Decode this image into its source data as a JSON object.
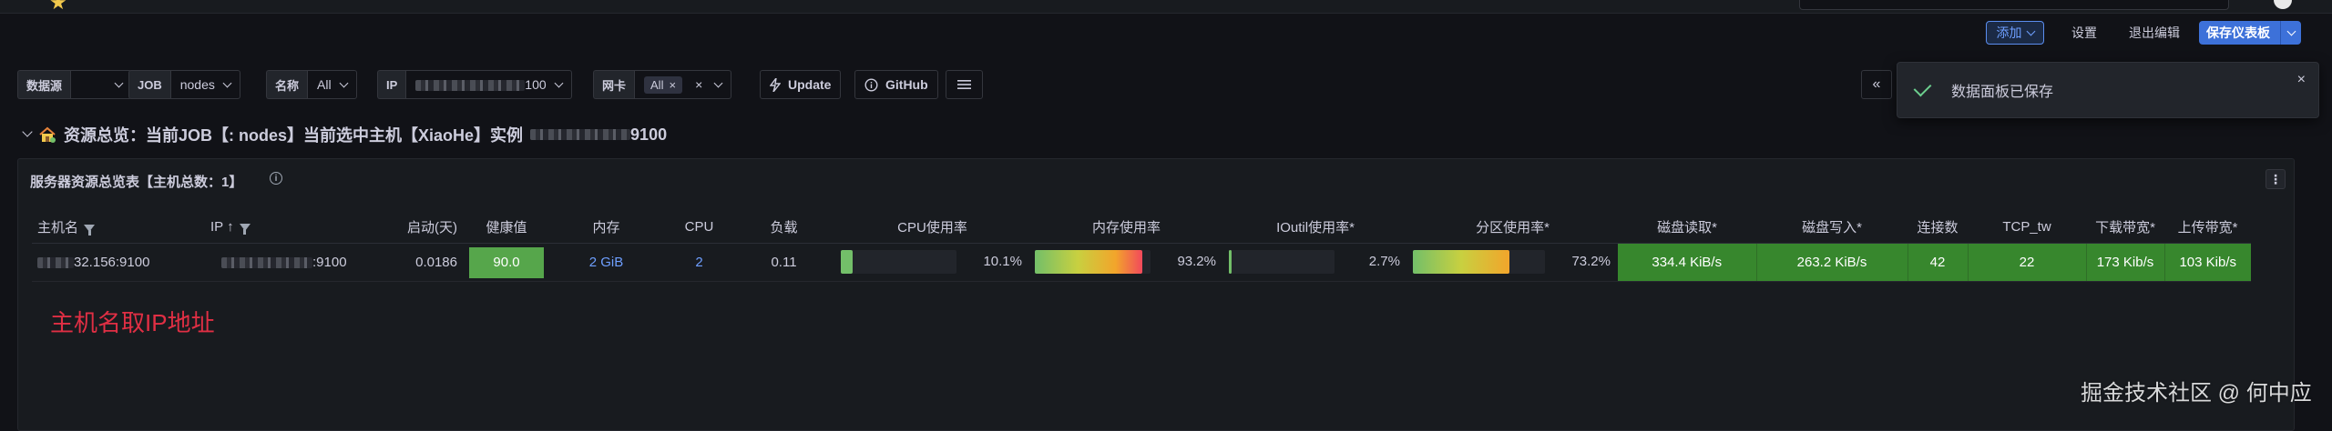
{
  "toolbar": {
    "add_label": "添加",
    "settings_label": "设置",
    "exit_edit_label": "退出编辑",
    "save_label": "保存仪表板"
  },
  "variables": {
    "datasource": {
      "label": "数据源",
      "value": ""
    },
    "job": {
      "label": "JOB",
      "value": "nodes"
    },
    "name": {
      "label": "名称",
      "value": "All"
    },
    "ip": {
      "label": "IP",
      "value_suffix": "100"
    },
    "nic": {
      "label": "网卡",
      "pill": "All"
    }
  },
  "links": {
    "update_label": "Update",
    "github_label": "GitHub"
  },
  "toast": {
    "message": "数据面板已保存"
  },
  "row": {
    "title_prefix": "资源总览：当前JOB【: nodes】当前选中主机【XiaoHe】实例",
    "title_suffix": "9100"
  },
  "panel": {
    "title": "服务器资源总览表【主机总数：1】",
    "columns": {
      "hostname": "主机名",
      "ip": "IP",
      "uptime": "启动(天)",
      "health": "健康值",
      "memory": "内存",
      "cpu": "CPU",
      "load": "负载",
      "cpu_usage": "CPU使用率",
      "mem_usage": "内存使用率",
      "ioutil": "IOutil使用率*",
      "partition": "分区使用率*",
      "disk_read": "磁盘读取*",
      "disk_write": "磁盘写入*",
      "connections": "连接数",
      "tcp_tw": "TCP_tw",
      "download": "下载带宽*",
      "upload": "上传带宽*"
    },
    "rows": [
      {
        "hostname_suffix": "32.156:9100",
        "ip_suffix": ":9100",
        "uptime": "0.0186",
        "health": "90.0",
        "memory": "2 GiB",
        "cpu": "2",
        "load": "0.11",
        "cpu_usage": "10.1%",
        "cpu_usage_fraction": 0.101,
        "mem_usage": "93.2%",
        "mem_usage_fraction": 0.932,
        "ioutil": "2.7%",
        "ioutil_fraction": 0.027,
        "partition": "73.2%",
        "partition_fraction": 0.732,
        "disk_read": "334.4 KiB/s",
        "disk_write": "263.2 KiB/s",
        "connections": "42",
        "tcp_tw": "22",
        "download": "173 Kib/s",
        "upload": "103 Kib/s"
      }
    ]
  },
  "annotation": "主机名取IP地址",
  "watermark": "掘金技术社区 @ 何中应",
  "colors": {
    "background": "#111217",
    "panel": "#181b1f",
    "primary": "#3d71d9",
    "green": "#37872d",
    "annotation_red": "#e02f44"
  }
}
